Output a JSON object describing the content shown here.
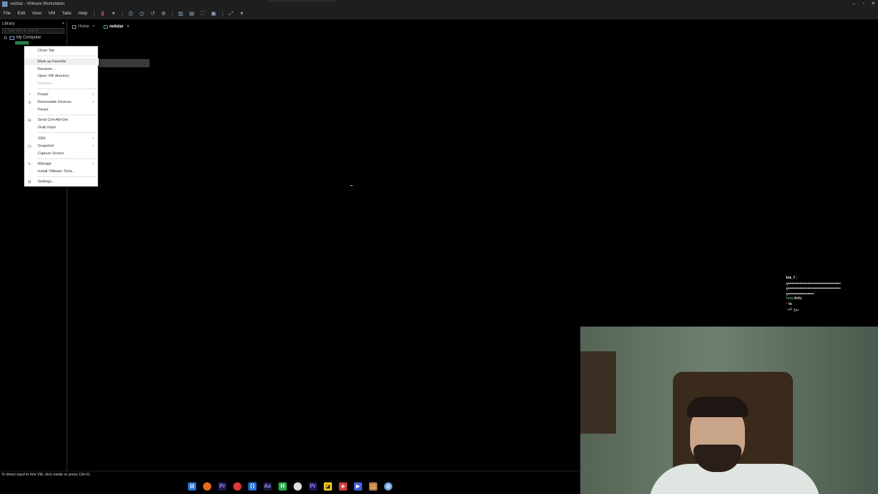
{
  "window": {
    "title": "redstar - VMware Workstation"
  },
  "menu": {
    "items": [
      "File",
      "Edit",
      "View",
      "VM",
      "Tabs",
      "Help"
    ]
  },
  "library": {
    "title": "Library",
    "close": "×",
    "search_placeholder": "Type here to search",
    "root": "My Computer"
  },
  "tabs": [
    {
      "label": "Home",
      "close": "×"
    },
    {
      "label": "redstar",
      "close": "×"
    }
  ],
  "context_menu": {
    "items": [
      {
        "label": "Close Tab"
      },
      {
        "label": "Mark as Favorite"
      },
      {
        "label": "Rename..."
      },
      {
        "label": "Open VM directory"
      },
      {
        "label": "Remove"
      },
      {
        "label": "Power",
        "submenu": true
      },
      {
        "label": "Removable Devices",
        "submenu": true
      },
      {
        "label": "Pause"
      },
      {
        "label": "Send Ctrl+Alt+Del"
      },
      {
        "label": "Grab Input"
      },
      {
        "label": "SSH",
        "submenu": true
      },
      {
        "label": "Snapshot",
        "submenu": true
      },
      {
        "label": "Capture Screen"
      },
      {
        "label": "Manage",
        "submenu": true
      },
      {
        "label": "Install VMware Tools..."
      },
      {
        "label": "Settings..."
      }
    ],
    "arrow": "›"
  },
  "statusbar": {
    "text": "To direct input to this VM, click inside or press Ctrl+G."
  },
  "chat": {
    "user1": "kra_7 :",
    "line1": "ععععععععععععععععععععععععععععععععع",
    "line2": "ععععععععععععععععععععععععععععععععع",
    "line3": "ععععععععععععععععع",
    "line4_user": "tuqq",
    "line4_msg": "diddy",
    "line5_msg": "هلا",
    "line6_msg": "روح نام"
  },
  "colors": {
    "accent": "#2b7a4b",
    "menu_bg": "#ffffff",
    "pause": "#e05050"
  }
}
